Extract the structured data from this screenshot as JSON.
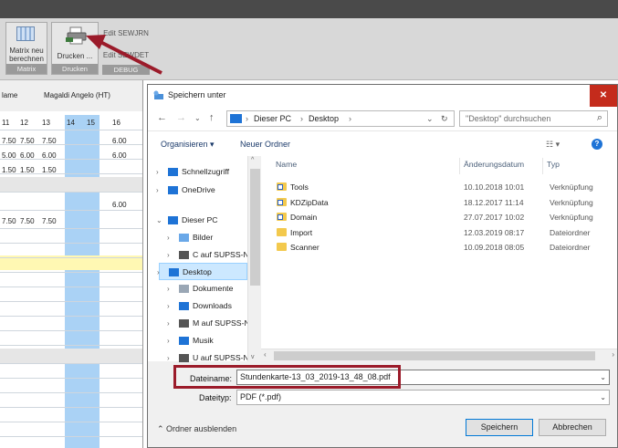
{
  "ribbon": {
    "matrix_btn": "Matrix neu\nberechnen",
    "matrix_group": "Matrix",
    "print_btn": "Drucken ...",
    "print_group": "Drucken",
    "edit1": "Edit SEWJRN",
    "edit2": "Edit SEWDET",
    "debug_group": "DEBUG"
  },
  "grid": {
    "name_label": "lame",
    "person": "Magaldi Angelo (HT)",
    "day_headers": [
      "11",
      "12",
      "13",
      "14",
      "15",
      "16"
    ],
    "rows": [
      [
        "7.50",
        "7.50",
        "7.50",
        "",
        "",
        "6.00"
      ],
      [
        "5.00",
        "6.00",
        "6.00",
        "",
        "",
        "6.00"
      ],
      [
        "1.50",
        "1.50",
        "1.50",
        "",
        "",
        ""
      ],
      [
        "",
        "",
        "",
        "",
        "",
        "6.00"
      ],
      [
        "7.50",
        "7.50",
        "7.50",
        "",
        "",
        ""
      ]
    ]
  },
  "dialog": {
    "title": "Speichern unter",
    "address": {
      "pc": "Dieser PC",
      "folder": "Desktop"
    },
    "search_placeholder": "\"Desktop\" durchsuchen",
    "cmd": {
      "organize": "Organisieren ▾",
      "new_folder": "Neuer Ordner"
    },
    "nav": [
      {
        "label": "Schnellzugriff",
        "icon": "star-icon"
      },
      {
        "label": "OneDrive",
        "icon": "cloud-icon"
      },
      {
        "label": "Dieser PC",
        "icon": "pc-icon"
      },
      {
        "label": "Bilder",
        "icon": "pictures-icon"
      },
      {
        "label": "C auf SUPSS-NB",
        "icon": "drive-icon"
      },
      {
        "label": "Desktop",
        "icon": "desktop-icon",
        "selected": true
      },
      {
        "label": "Dokumente",
        "icon": "documents-icon"
      },
      {
        "label": "Downloads",
        "icon": "download-icon"
      },
      {
        "label": "M auf SUPSS-NE",
        "icon": "drive-icon"
      },
      {
        "label": "Musik",
        "icon": "music-icon"
      },
      {
        "label": "U auf SUPSS-NB",
        "icon": "drive-icon"
      }
    ],
    "columns": {
      "name": "Name",
      "date": "Änderungsdatum",
      "type": "Typ"
    },
    "files": [
      {
        "name": "Tools",
        "date": "10.10.2018 10:01",
        "type": "Verknüpfung",
        "shortcut": true
      },
      {
        "name": "KDZipData",
        "date": "18.12.2017 11:14",
        "type": "Verknüpfung",
        "shortcut": true
      },
      {
        "name": "Domain",
        "date": "27.07.2017 10:02",
        "type": "Verknüpfung",
        "shortcut": true
      },
      {
        "name": "Import",
        "date": "12.03.2019 08:17",
        "type": "Dateiordner",
        "shortcut": false
      },
      {
        "name": "Scanner",
        "date": "10.09.2018 08:05",
        "type": "Dateiordner",
        "shortcut": false
      }
    ],
    "filename_label": "Dateiname:",
    "filename_value": "Stundenkarte-13_03_2019-13_48_08.pdf",
    "filetype_label": "Dateityp:",
    "filetype_value": "PDF (*.pdf)",
    "hide_folders": "Ordner ausblenden",
    "save": "Speichern",
    "cancel": "Abbrechen"
  },
  "colors": {
    "accent": "#0078d7",
    "close": "#c42b1c",
    "highlight_box": "#9b1b2a",
    "grid_blue": "#aad2f5"
  }
}
